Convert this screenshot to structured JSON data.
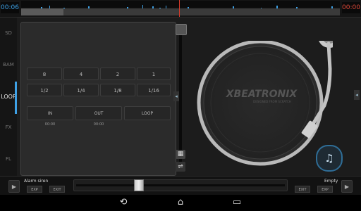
{
  "top": {
    "time_left": "00:06",
    "time_right": "00:00"
  },
  "side_tabs": [
    {
      "label": "SD",
      "active": false
    },
    {
      "label": "BAM",
      "active": false
    },
    {
      "label": "LOOP",
      "active": true
    },
    {
      "label": "FX",
      "active": false
    },
    {
      "label": "FL",
      "active": false
    }
  ],
  "loop_panel": {
    "row1": [
      "8",
      "4",
      "2",
      "1"
    ],
    "row2": [
      "1/2",
      "1/4",
      "1/8",
      "1/16"
    ],
    "cue": {
      "in_label": "IN",
      "out_label": "OUT",
      "loop_label": "LOOP",
      "in_time": "00:00",
      "out_time": "00:00"
    }
  },
  "turntable": {
    "brand": "XBEATRONIX",
    "tagline": "DESIGNED FROM SCRATCH"
  },
  "icons": {
    "sync": "music-note-icon",
    "grid": "grid-icon",
    "reset": "reset-icon",
    "play": "play-icon"
  },
  "bottom": {
    "left_title": "Alarm siren",
    "right_title": "Empty",
    "left_buttons": [
      "EXP",
      "EXIT"
    ],
    "right_buttons": [
      "EXIT",
      "EXP"
    ],
    "crossfader_position": 0.29
  },
  "colors": {
    "accent": "#3ea1e6",
    "cursor": "#d43a2a"
  }
}
